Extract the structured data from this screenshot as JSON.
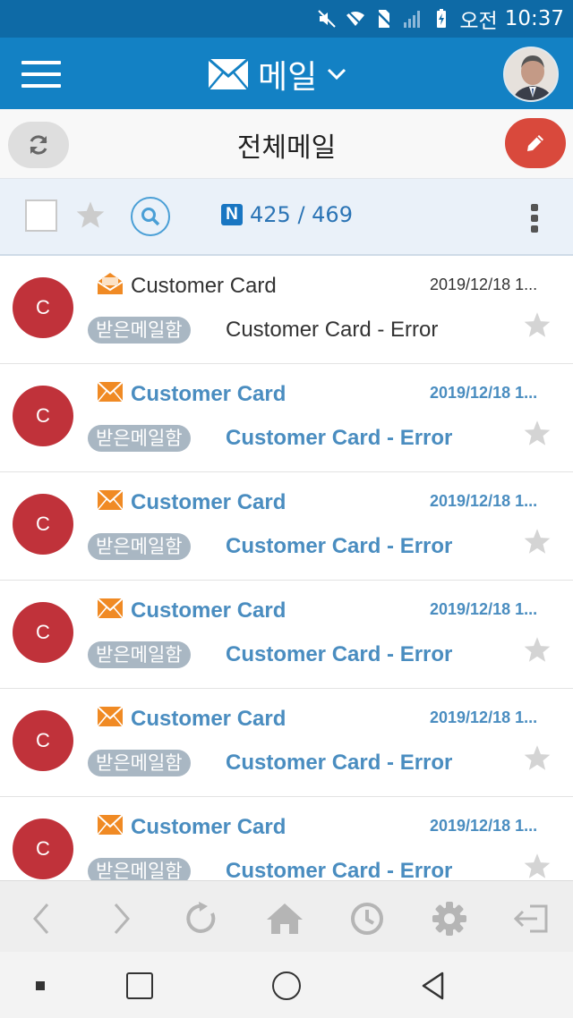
{
  "status_bar": {
    "time_prefix": "오전",
    "time": "10:37",
    "icons": [
      "mute-icon",
      "wifi-icon",
      "no-sim-icon",
      "signal-icon",
      "battery-charging-icon"
    ]
  },
  "header": {
    "title": "메일",
    "menu_icon": "hamburger-icon",
    "title_icon": "envelope-icon",
    "dropdown_icon": "chevron-down-icon"
  },
  "subheader": {
    "title": "전체메일",
    "refresh_icon": "refresh-icon",
    "compose_icon": "pencil-icon"
  },
  "toolbar": {
    "count_current": "425",
    "count_separator": " / ",
    "count_total": "469",
    "new_badge": "N"
  },
  "mails": [
    {
      "avatar_letter": "C",
      "sender": "Customer Card",
      "date": "2019/12/18 1...",
      "folder": "받은메일함",
      "subject": "Customer Card - Error",
      "unread": false
    },
    {
      "avatar_letter": "C",
      "sender": "Customer Card",
      "date": "2019/12/18 1...",
      "folder": "받은메일함",
      "subject": "Customer Card - Error",
      "unread": true
    },
    {
      "avatar_letter": "C",
      "sender": "Customer Card",
      "date": "2019/12/18 1...",
      "folder": "받은메일함",
      "subject": "Customer Card - Error",
      "unread": true
    },
    {
      "avatar_letter": "C",
      "sender": "Customer Card",
      "date": "2019/12/18 1...",
      "folder": "받은메일함",
      "subject": "Customer Card - Error",
      "unread": true
    },
    {
      "avatar_letter": "C",
      "sender": "Customer Card",
      "date": "2019/12/18 1...",
      "folder": "받은메일함",
      "subject": "Customer Card - Error",
      "unread": true
    },
    {
      "avatar_letter": "C",
      "sender": "Customer Card",
      "date": "2019/12/18 1...",
      "folder": "받은메일함",
      "subject": "Customer Card - Error",
      "unread": true
    }
  ],
  "browser_bar": {
    "buttons": [
      "back-icon",
      "forward-icon",
      "reload-icon",
      "home-icon",
      "history-icon",
      "settings-icon",
      "logout-icon"
    ]
  },
  "nav_bar": {
    "buttons": [
      "dot-icon",
      "recents-icon",
      "home-circle-icon",
      "back-triangle-icon"
    ]
  },
  "colors": {
    "status_bar": "#0e6aa6",
    "app_bar": "#1381c4",
    "compose": "#d9493c",
    "avatar": "#c0323a",
    "unread_text": "#4a8dc0",
    "badge": "#a9b7c3",
    "envelope_new": "#f08a24"
  }
}
